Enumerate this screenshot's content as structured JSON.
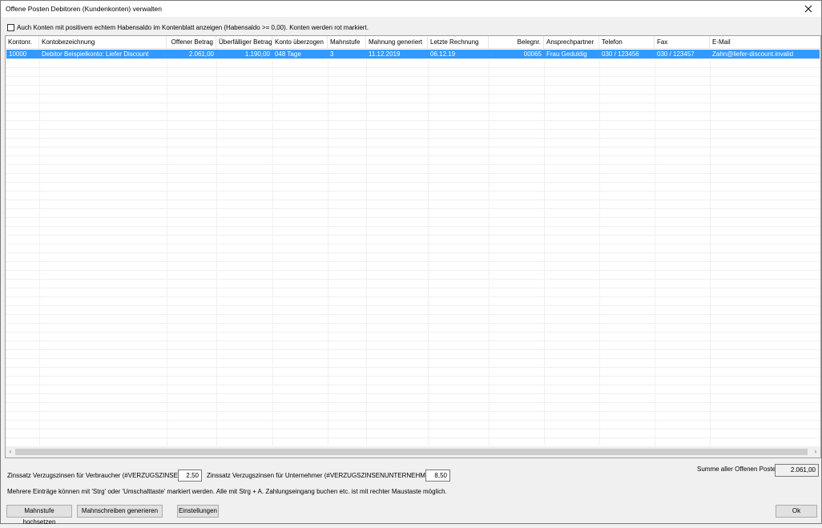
{
  "window": {
    "title": "Offene Posten Debitoren (Kundenkonten) verwalten",
    "close_icon": "close-icon"
  },
  "option": {
    "checked": false,
    "label": "Auch Konten mit positivem echtem Habensaldo im Kontenblatt anzeigen (Habensaldo >= 0,00). Konten werden rot markiert."
  },
  "table": {
    "columns": [
      "Kontonr.",
      "Kontobezeichnung",
      "Offener Betrag",
      "Überfälliger Betrag",
      "Konto überzogen",
      "Mahnstufe",
      "Mahnung generiert",
      "Letzte Rechnung",
      "Belegnr.",
      "Ansprechpartner",
      "Telefon",
      "Fax",
      "E-Mail"
    ],
    "sorted_column": "Letzte Rechnung",
    "rows": [
      {
        "kontonr": "10000",
        "bezeichnung": "Debitor Beispielkonto: Liefer Discount",
        "offener_betrag": "2.061,00",
        "ueberfaelliger_betrag": "1.190,00",
        "konto_ueberzogen": "048 Tage",
        "mahnstufe": "3",
        "mahnung_generiert": "11.12.2019",
        "letzte_rechnung": "06.12.19",
        "belegnr": "00065",
        "ansprechpartner": "Frau Geduldig",
        "telefon": "030 / 123456",
        "fax": "030 / 123457",
        "email": "Zahn@liefer-discount.invalid",
        "selected": true
      }
    ]
  },
  "footer": {
    "zins_verbraucher_label": "Zinssatz Verzugszinsen für Verbraucher (#VERZUGSZINSEN#)",
    "zins_verbraucher_value": "2,50",
    "zins_unternehmer_label": "Zinssatz Verzugszinsen für Unternehmer (#VERZUGSZINSENUNTERNEHMER#)",
    "zins_unternehmer_value": "8,50",
    "summe_label": "Summe aller Offenen Posten:",
    "summe_value": "2.061,00",
    "hint": "Mehrere Einträge können mit 'Strg' oder 'Umschalttaste' markiert werden. Alle mit Strg + A. Zahlungseingang buchen etc. ist mit rechter Maustaste möglich."
  },
  "buttons": {
    "mahnstufe": "Mahnstufe hochsetzen",
    "mahnschreiben": "Mahnschreiben generieren",
    "einstellungen": "Einstellungen",
    "ok": "Ok"
  },
  "colors": {
    "selection": "#3399ff",
    "background": "#f0f0f0"
  }
}
